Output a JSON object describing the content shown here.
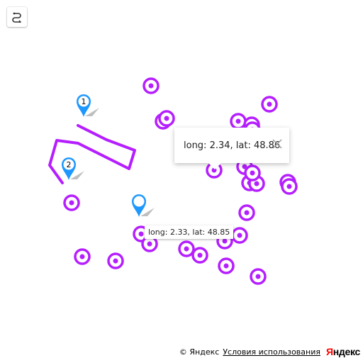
{
  "controls": {
    "route_icon": "route-icon"
  },
  "markers": [
    {
      "label": "1",
      "color": "#1e98ff"
    },
    {
      "label": "2",
      "color": "#1e98ff"
    },
    {
      "label": "",
      "color": "#1e98ff"
    }
  ],
  "points_color": "#b51eff",
  "route_color": "#b51eff",
  "balloon": {
    "text": "long: 2.34, lat: 48.86",
    "close_icon": "close-icon"
  },
  "hint": {
    "text": "long: 2.33, lat: 48.85"
  },
  "copyright": {
    "text": "© Яндекс",
    "terms_label": "Условия использования",
    "logo_first": "Я",
    "logo_rest": "ндекс"
  }
}
